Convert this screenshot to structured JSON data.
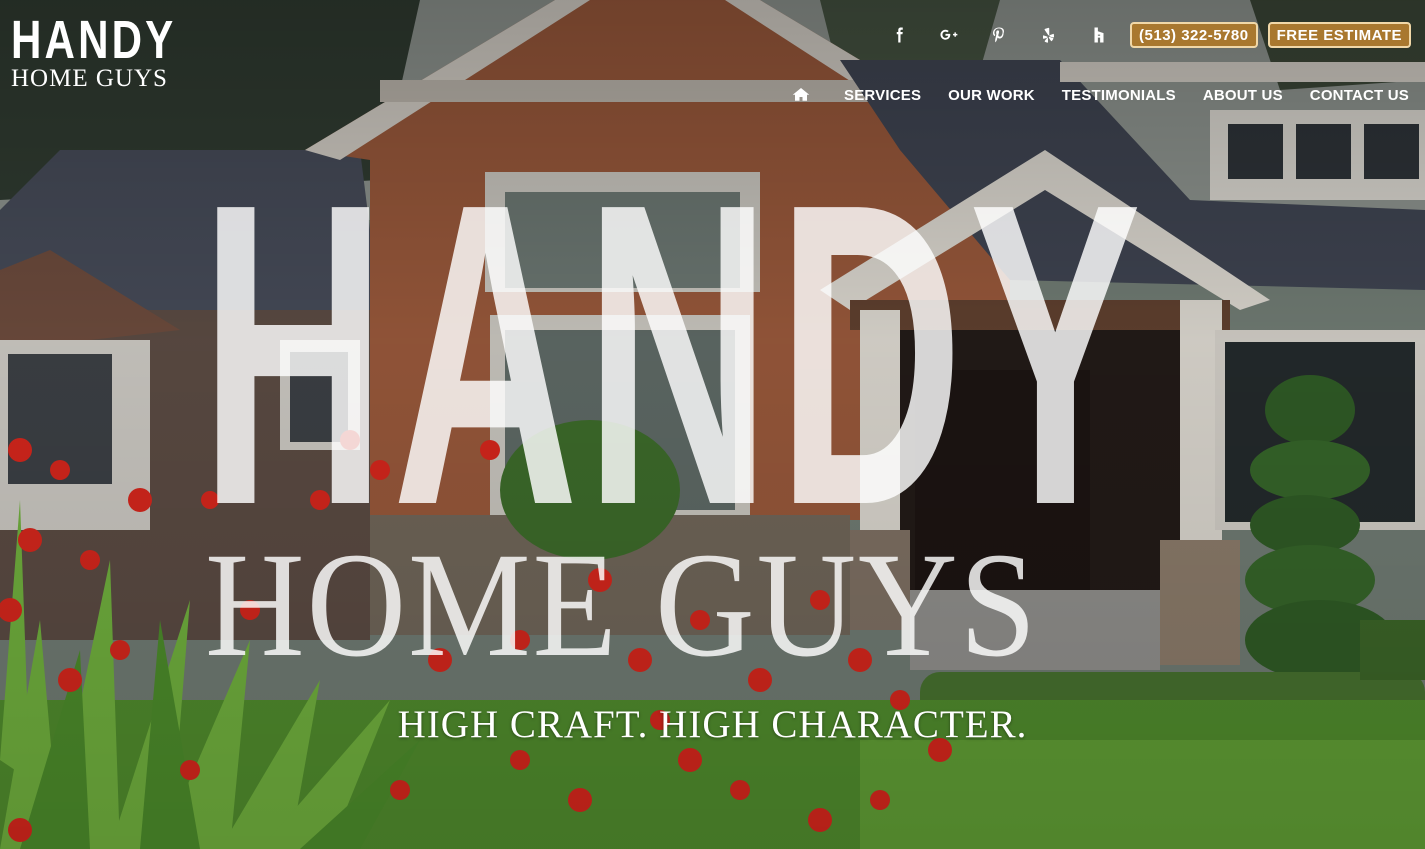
{
  "brand": {
    "logo_line1": "HANDY",
    "logo_line2": "HOME GUYS"
  },
  "social": [
    {
      "name": "facebook-icon",
      "glyph": "f"
    },
    {
      "name": "google-plus-icon",
      "glyph": "G+"
    },
    {
      "name": "pinterest-icon",
      "glyph": "p"
    },
    {
      "name": "yelp-icon",
      "glyph": "yelp"
    },
    {
      "name": "houzz-icon",
      "glyph": "h"
    }
  ],
  "cta": {
    "phone": "(513) 322-5780",
    "estimate": "FREE ESTIMATE"
  },
  "nav": {
    "home_icon": "home-icon",
    "items": [
      "SERVICES",
      "OUR WORK",
      "TESTIMONIALS",
      "ABOUT US",
      "CONTACT US"
    ]
  },
  "hero": {
    "title": "HANDY",
    "subtitle": "HOME GUYS",
    "tagline": "HIGH CRAFT. HIGH CHARACTER."
  },
  "colors": {
    "cta_background": "#a9782f",
    "cta_border": "#f1d8a8",
    "text": "#ffffff"
  }
}
